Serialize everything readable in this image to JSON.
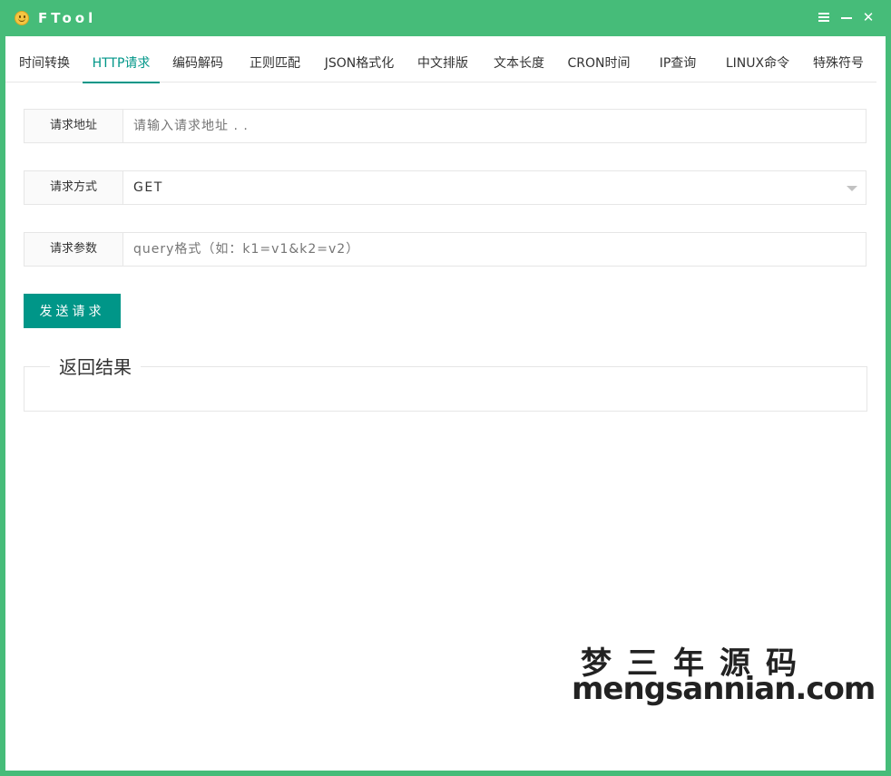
{
  "window": {
    "title": "FTool",
    "accent_color": "#46bc79",
    "primary_color": "#009688",
    "controls": [
      "menu-icon",
      "minimize-icon",
      "close-icon"
    ]
  },
  "tabs": [
    {
      "label": "时间转换",
      "active": false
    },
    {
      "label": "HTTP请求",
      "active": true
    },
    {
      "label": "编码解码",
      "active": false
    },
    {
      "label": "正则匹配",
      "active": false
    },
    {
      "label": "JSON格式化",
      "active": false
    },
    {
      "label": "中文排版",
      "active": false
    },
    {
      "label": "文本长度",
      "active": false
    },
    {
      "label": "CRON时间",
      "active": false
    },
    {
      "label": "IP查询",
      "active": false
    },
    {
      "label": "LINUX命令",
      "active": false
    },
    {
      "label": "特殊符号",
      "active": false
    }
  ],
  "form": {
    "url": {
      "label": "请求地址",
      "value": "",
      "placeholder": "请输入请求地址 . ."
    },
    "method": {
      "label": "请求方式",
      "value": "GET"
    },
    "params": {
      "label": "请求参数",
      "value": "",
      "placeholder": "query格式（如：k1=v1&k2=v2）"
    },
    "submit_label": "发送请求"
  },
  "result": {
    "legend": "返回结果",
    "content": ""
  },
  "watermark": {
    "line1": "梦三年源码",
    "line2": "mengsannian.com"
  }
}
